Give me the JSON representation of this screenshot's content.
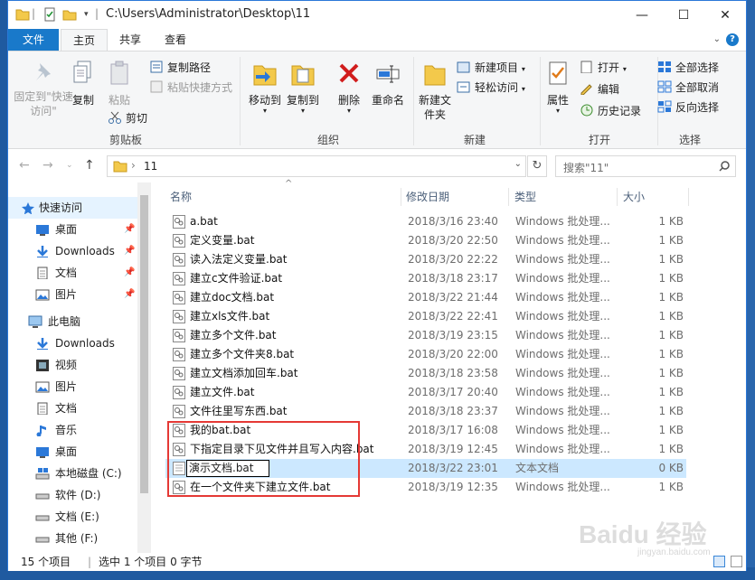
{
  "window": {
    "title_path": "C:\\Users\\Administrator\\Desktop\\11",
    "minimize": "—",
    "maximize": "☐",
    "close": "✕"
  },
  "ribbon_tabs": [
    "文件",
    "主页",
    "共享",
    "查看"
  ],
  "ribbon": {
    "clipboard": {
      "label": "剪贴板",
      "pin": "固定到\"快速访问\"",
      "copy": "复制",
      "paste": "粘贴",
      "copy_path": "复制路径",
      "paste_shortcut": "粘贴快捷方式",
      "cut": "剪切"
    },
    "organize": {
      "label": "组织",
      "move_to": "移动到",
      "copy_to": "复制到",
      "delete": "删除",
      "rename": "重命名"
    },
    "new": {
      "label": "新建",
      "new_folder": "新建文件夹",
      "new_item": "新建项目",
      "easy_access": "轻松访问"
    },
    "open": {
      "label": "打开",
      "properties": "属性",
      "open": "打开",
      "edit": "编辑",
      "history": "历史记录"
    },
    "select": {
      "label": "选择",
      "select_all": "全部选择",
      "select_none": "全部取消",
      "invert": "反向选择"
    }
  },
  "address": {
    "path": "11",
    "search_placeholder": "搜索\"11\""
  },
  "nav": {
    "quick_access": "快速访问",
    "qa_items": [
      "桌面",
      "Downloads",
      "文档",
      "图片"
    ],
    "this_pc": "此电脑",
    "pc_items": [
      "Downloads",
      "视频",
      "图片",
      "文档",
      "音乐",
      "桌面",
      "本地磁盘 (C:)",
      "软件 (D:)",
      "文档 (E:)",
      "其他 (F:)"
    ]
  },
  "columns": {
    "name": "名称",
    "date": "修改日期",
    "type": "类型",
    "size": "大小"
  },
  "files": [
    {
      "name": "a.bat",
      "date": "2018/3/16 23:40",
      "type": "Windows 批处理...",
      "size": "1 KB"
    },
    {
      "name": "定义变量.bat",
      "date": "2018/3/20 22:50",
      "type": "Windows 批处理...",
      "size": "1 KB"
    },
    {
      "name": "读入法定义变量.bat",
      "date": "2018/3/20 22:22",
      "type": "Windows 批处理...",
      "size": "1 KB"
    },
    {
      "name": "建立c文件验证.bat",
      "date": "2018/3/18 23:17",
      "type": "Windows 批处理...",
      "size": "1 KB"
    },
    {
      "name": "建立doc文档.bat",
      "date": "2018/3/22 21:44",
      "type": "Windows 批处理...",
      "size": "1 KB"
    },
    {
      "name": "建立xls文件.bat",
      "date": "2018/3/22 22:41",
      "type": "Windows 批处理...",
      "size": "1 KB"
    },
    {
      "name": "建立多个文件.bat",
      "date": "2018/3/19 23:15",
      "type": "Windows 批处理...",
      "size": "1 KB"
    },
    {
      "name": "建立多个文件夹8.bat",
      "date": "2018/3/20 22:00",
      "type": "Windows 批处理...",
      "size": "1 KB"
    },
    {
      "name": "建立文档添加回车.bat",
      "date": "2018/3/18 23:58",
      "type": "Windows 批处理...",
      "size": "1 KB"
    },
    {
      "name": "建立文件.bat",
      "date": "2018/3/17 20:40",
      "type": "Windows 批处理...",
      "size": "1 KB"
    },
    {
      "name": "文件往里写东西.bat",
      "date": "2018/3/18 23:37",
      "type": "Windows 批处理...",
      "size": "1 KB"
    },
    {
      "name": "我的bat.bat",
      "date": "2018/3/17 16:08",
      "type": "Windows 批处理...",
      "size": "1 KB"
    },
    {
      "name": "下指定目录下见文件并且写入内容.bat",
      "date": "2018/3/19 12:45",
      "type": "Windows 批处理...",
      "size": "1 KB"
    },
    {
      "name": "演示文档.bat",
      "date": "2018/3/22 23:01",
      "type": "文本文档",
      "size": "0 KB",
      "renaming": true
    },
    {
      "name": "在一个文件夹下建立文件.bat",
      "date": "2018/3/19 12:35",
      "type": "Windows 批处理...",
      "size": "1 KB"
    }
  ],
  "status": {
    "count": "15 个项目",
    "selection": "选中 1 个项目  0 字节"
  },
  "watermark": {
    "logo": "Baidu 经验",
    "url": "jingyan.baidu.com"
  }
}
